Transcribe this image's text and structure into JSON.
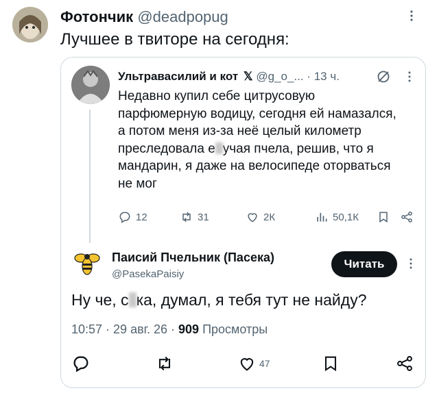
{
  "outer": {
    "name": "Фотончик",
    "handle": "@deadpopug",
    "text": "Лучшее в твиторе на сегодня:"
  },
  "quoted": {
    "name": "Ультравасилий и кот",
    "handle": "@g_o_...",
    "time": "· 13 ч.",
    "lines": [
      "Недавно купил себе цитрусовую",
      "парфюмерную водицу, сегодня ей намазался,",
      "а потом меня из-за неё целый километр"
    ],
    "line4_a": "преследовала е",
    "line4_b": "учая пчела, решив, что я",
    "line5": "мандарин, я даже на велосипеде оторваться",
    "line6": "не мог",
    "stats": {
      "replies": "12",
      "retweets": "31",
      "likes": "2К",
      "views": "50,1К"
    }
  },
  "reply": {
    "name": "Паисий Пчельник (Пасека)",
    "handle": "@PasekaPaisiy",
    "follow_label": "Читать",
    "text_a": "Ну че, с",
    "text_b": "ка, думал, я тебя тут не найду?",
    "meta_prefix": "10:57 · 29 авг. 26 · ",
    "views_count": "909",
    "views_label": " Просмотры",
    "likes": "47"
  },
  "colors": {
    "text": "#0f1419",
    "muted": "#536471",
    "border": "#cfd9de",
    "button": "#0f1419"
  },
  "icons": [
    "reply-icon",
    "retweet-icon",
    "heart-icon",
    "views-icon",
    "bookmark-icon",
    "share-icon",
    "x-logo-icon",
    "grok-icon",
    "more-icon",
    "bee-icon"
  ]
}
